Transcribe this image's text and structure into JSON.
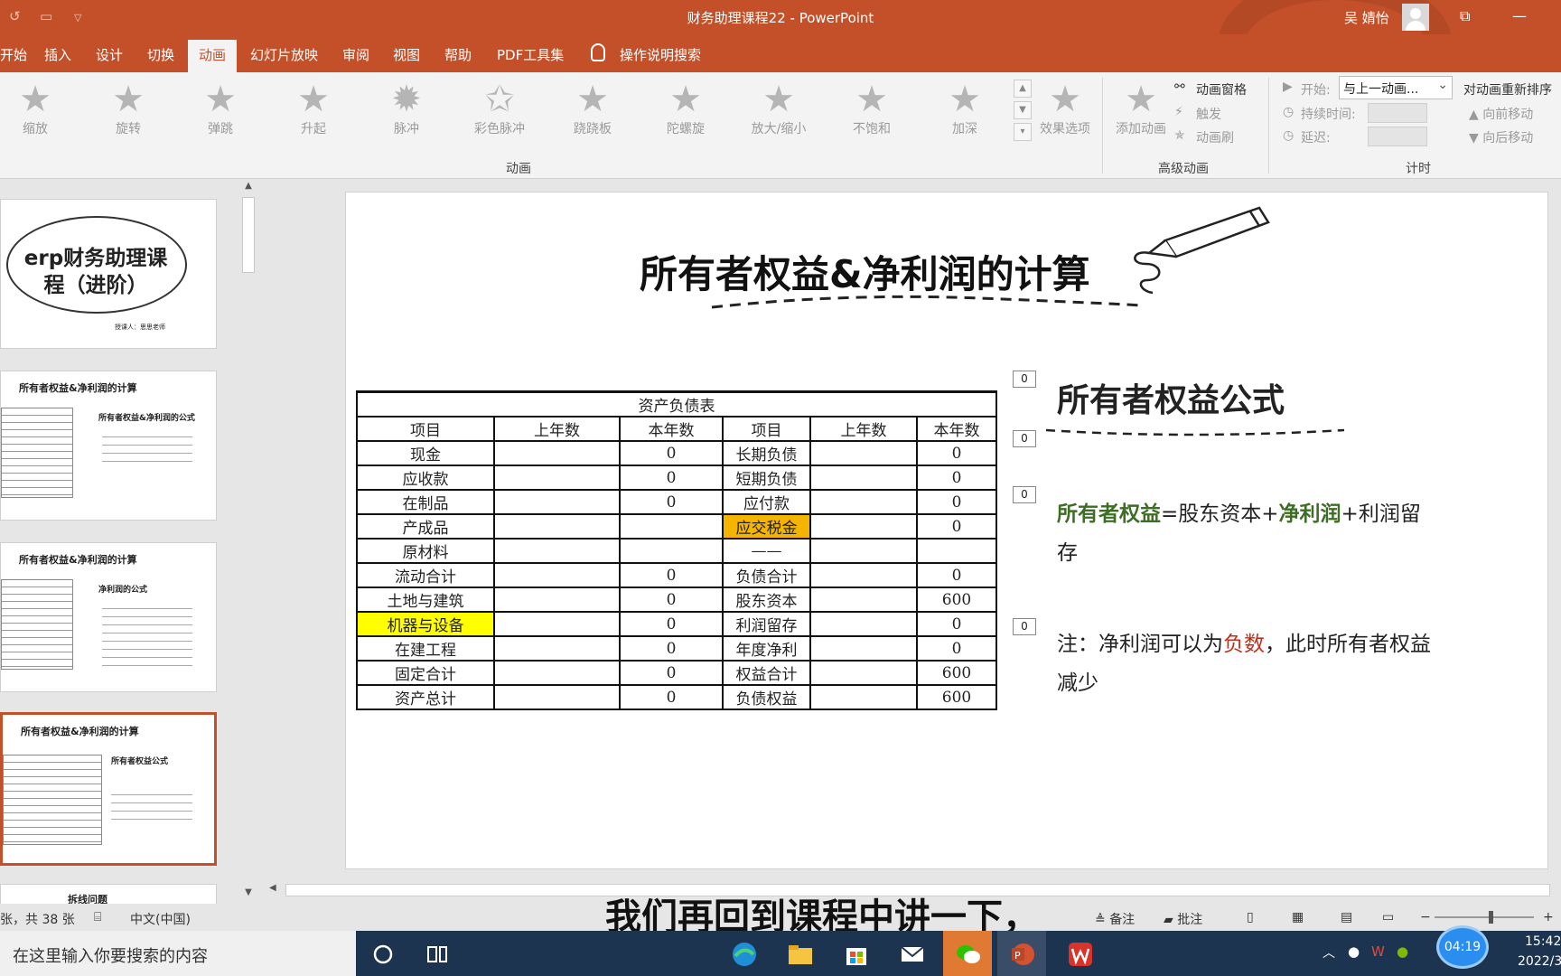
{
  "window": {
    "title": "财务助理课程22 - PowerPoint",
    "user": "吴 婧怡"
  },
  "tabs": [
    "开始",
    "插入",
    "设计",
    "切换",
    "动画",
    "幻灯片放映",
    "审阅",
    "视图",
    "帮助",
    "PDF工具集"
  ],
  "tell_me": "操作说明搜索",
  "ribbon": {
    "animations": [
      "缩放",
      "旋转",
      "弹跳",
      "升起",
      "脉冲",
      "彩色脉冲",
      "跷跷板",
      "陀螺旋",
      "放大/缩小",
      "不饱和",
      "加深"
    ],
    "effect_options": "效果选项",
    "group_animation": "动画",
    "add_animation": "添加动画",
    "animation_pane": "动画窗格",
    "trigger": "触发",
    "animation_painter": "动画刷",
    "group_advanced": "高级动画",
    "start_label": "开始:",
    "start_value": "与上一动画...",
    "duration_label": "持续时间:",
    "delay_label": "延迟:",
    "reorder": "对动画重新排序",
    "move_earlier": "向前移动",
    "move_later": "向后移动",
    "group_timing": "计时"
  },
  "thumbnails": {
    "t1_title": "erp财务助理课程（进阶）",
    "t1_sub": "授课人：思思老师",
    "t2_title": "所有者权益&净利润的计算",
    "t2_sub": "所有者权益&净利润的公式",
    "t3_title": "所有者权益&净利润的计算",
    "t3_sub": "净利润的公式",
    "t4_title": "所有者权益&净利润的计算",
    "t4_sub": "所有者权益公式",
    "t5_title": "拆线问题"
  },
  "slide": {
    "title": "所有者权益&净利润的计算",
    "table_caption": "资产负债表",
    "headers": [
      "项目",
      "上年数",
      "本年数",
      "项目",
      "上年数",
      "本年数"
    ],
    "rows": [
      [
        "现金",
        "",
        "0",
        "长期负债",
        "",
        "0"
      ],
      [
        "应收款",
        "",
        "0",
        "短期负债",
        "",
        "0"
      ],
      [
        "在制品",
        "",
        "0",
        "应付款",
        "",
        "0"
      ],
      [
        "产成品",
        "",
        "",
        "应交税金",
        "",
        "0"
      ],
      [
        "原材料",
        "",
        "",
        "——",
        "",
        ""
      ],
      [
        "流动合计",
        "",
        "0",
        "负债合计",
        "",
        "0"
      ],
      [
        "土地与建筑",
        "",
        "0",
        "股东资本",
        "",
        "600"
      ],
      [
        "机器与设备",
        "",
        "0",
        "利润留存",
        "",
        "0"
      ],
      [
        "在建工程",
        "",
        "0",
        "年度净利",
        "",
        "0"
      ],
      [
        "固定合计",
        "",
        "0",
        "权益合计",
        "",
        "600"
      ],
      [
        "资产总计",
        "",
        "0",
        "负债权益",
        "",
        "600"
      ]
    ],
    "anim_tags": [
      "0",
      "0",
      "0",
      "0"
    ],
    "heading": "所有者权益公式",
    "formula": {
      "owner_equity": "所有者权益",
      "eq_capital": "=股东资本+",
      "net_profit": "净利润",
      "retained": "+利润留存"
    },
    "note": {
      "prefix": "注：净利润可以为",
      "negative": "负数",
      "suffix": "，此时所有者权益减少"
    }
  },
  "subtitle": "我们再回到课程中讲一下，",
  "status": {
    "slide_count": "张，共 38 张",
    "language": "中文(中国)",
    "notes": "备注",
    "comments": "批注"
  },
  "taskbar": {
    "search_placeholder": "在这里输入你要搜索的内容",
    "timer": "04:19",
    "time": "15:42",
    "date": "2022/3"
  },
  "colors": {
    "accent": "#c4502a",
    "taskbar": "#1d3451",
    "highlight_yellow": "#ffff00",
    "highlight_orange": "#f5b400",
    "formula_green": "#3e6d24",
    "negative_red": "#c0311b"
  }
}
